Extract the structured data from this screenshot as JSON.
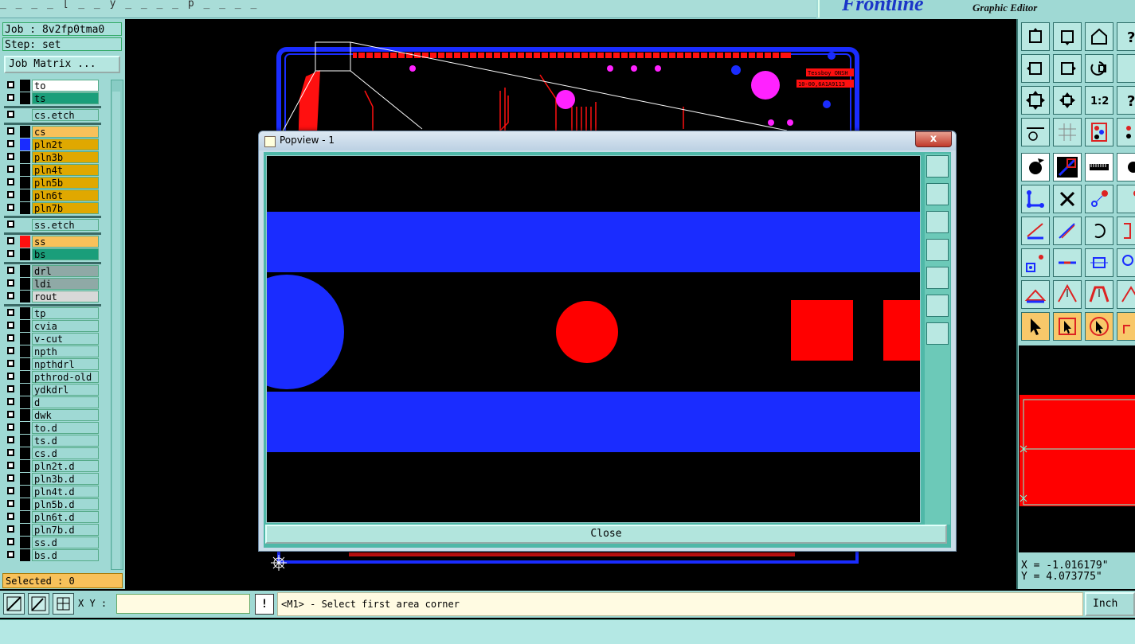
{
  "window": {
    "title_fragment": "_ _ _ _ [ _ _ y _ _ _ _ p _ _ _ _",
    "brand": "Frontline",
    "subtitle": "Graphic Editor"
  },
  "job": {
    "job_label": "Job : 8v2fp0tma0",
    "step_label": "Step: set",
    "matrix_button": "Job Matrix ..."
  },
  "layers": [
    {
      "name": "to",
      "color": "#ffffff",
      "marker": "#000000"
    },
    {
      "name": "ts",
      "color": "#1a9e7a",
      "marker": "#000000"
    },
    {
      "sep": true
    },
    {
      "name": "cs.etch",
      "color": "#9fd9d4",
      "marker": ""
    },
    {
      "sep": true
    },
    {
      "name": "cs",
      "color": "#f8c15a",
      "marker": "#000000"
    },
    {
      "name": "pln2t",
      "color": "#e0a800",
      "marker": "#1a2cff"
    },
    {
      "name": "pln3b",
      "color": "#e0a800",
      "marker": "#000000"
    },
    {
      "name": "pln4t",
      "color": "#e0a800",
      "marker": "#000000"
    },
    {
      "name": "pln5b",
      "color": "#e0a800",
      "marker": "#000000"
    },
    {
      "name": "pln6t",
      "color": "#e0a800",
      "marker": "#000000"
    },
    {
      "name": "pln7b",
      "color": "#e0a800",
      "marker": "#000000"
    },
    {
      "sep": true
    },
    {
      "name": "ss.etch",
      "color": "#9fd9d4",
      "marker": ""
    },
    {
      "sep": true
    },
    {
      "name": "ss",
      "color": "#f8c15a",
      "marker": "#ff1010"
    },
    {
      "name": "bs",
      "color": "#1a9e7a",
      "marker": "#000000"
    },
    {
      "sep": true
    },
    {
      "name": "drl",
      "color": "#8fa9a6",
      "marker": "#000000"
    },
    {
      "name": "ldi",
      "color": "#8fa9a6",
      "marker": "#000000"
    },
    {
      "name": "rout",
      "color": "#d8d8d8",
      "marker": "#000000"
    },
    {
      "sep": true
    },
    {
      "name": "tp",
      "color": "#9fd9d4",
      "marker": "#000000"
    },
    {
      "name": "cvia",
      "color": "#9fd9d4",
      "marker": "#000000"
    },
    {
      "name": "v-cut",
      "color": "#9fd9d4",
      "marker": "#000000"
    },
    {
      "name": "npth",
      "color": "#9fd9d4",
      "marker": "#000000"
    },
    {
      "name": "npthdrl",
      "color": "#9fd9d4",
      "marker": "#000000"
    },
    {
      "name": "pthrod-old",
      "color": "#9fd9d4",
      "marker": "#000000"
    },
    {
      "name": "ydkdrl",
      "color": "#9fd9d4",
      "marker": "#000000"
    },
    {
      "name": "d",
      "color": "#9fd9d4",
      "marker": "#000000"
    },
    {
      "name": "dwk",
      "color": "#9fd9d4",
      "marker": "#000000"
    },
    {
      "name": "to.d",
      "color": "#9fd9d4",
      "marker": "#000000"
    },
    {
      "name": "ts.d",
      "color": "#9fd9d4",
      "marker": "#000000"
    },
    {
      "name": "cs.d",
      "color": "#9fd9d4",
      "marker": "#000000"
    },
    {
      "name": "pln2t.d",
      "color": "#9fd9d4",
      "marker": "#000000"
    },
    {
      "name": "pln3b.d",
      "color": "#9fd9d4",
      "marker": "#000000"
    },
    {
      "name": "pln4t.d",
      "color": "#9fd9d4",
      "marker": "#000000"
    },
    {
      "name": "pln5b.d",
      "color": "#9fd9d4",
      "marker": "#000000"
    },
    {
      "name": "pln6t.d",
      "color": "#9fd9d4",
      "marker": "#000000"
    },
    {
      "name": "pln7b.d",
      "color": "#9fd9d4",
      "marker": "#000000"
    },
    {
      "name": "ss.d",
      "color": "#9fd9d4",
      "marker": "#000000"
    },
    {
      "name": "bs.d",
      "color": "#9fd9d4",
      "marker": "#000000"
    }
  ],
  "selected_label": "Selected : 0",
  "popview": {
    "title": "Popview - 1",
    "close_x": "x",
    "close_button": "Close"
  },
  "board": {
    "label_a": "Tessboy ONSH",
    "label_b": "10-00,6A1A9113"
  },
  "coords": {
    "x": "X = -1.016179\"",
    "y": "Y = 4.073775\""
  },
  "bottom": {
    "xy_label": "X Y :",
    "xy_value": "",
    "bang": "!",
    "status": "<M1> - Select first area corner",
    "unit": "Inch"
  },
  "colors": {
    "panel": "#9fd9d4",
    "top_layer": "#1a2cff",
    "pad": "#ff0000",
    "via": "#ff22ff",
    "highlight": "#f8c15a"
  }
}
